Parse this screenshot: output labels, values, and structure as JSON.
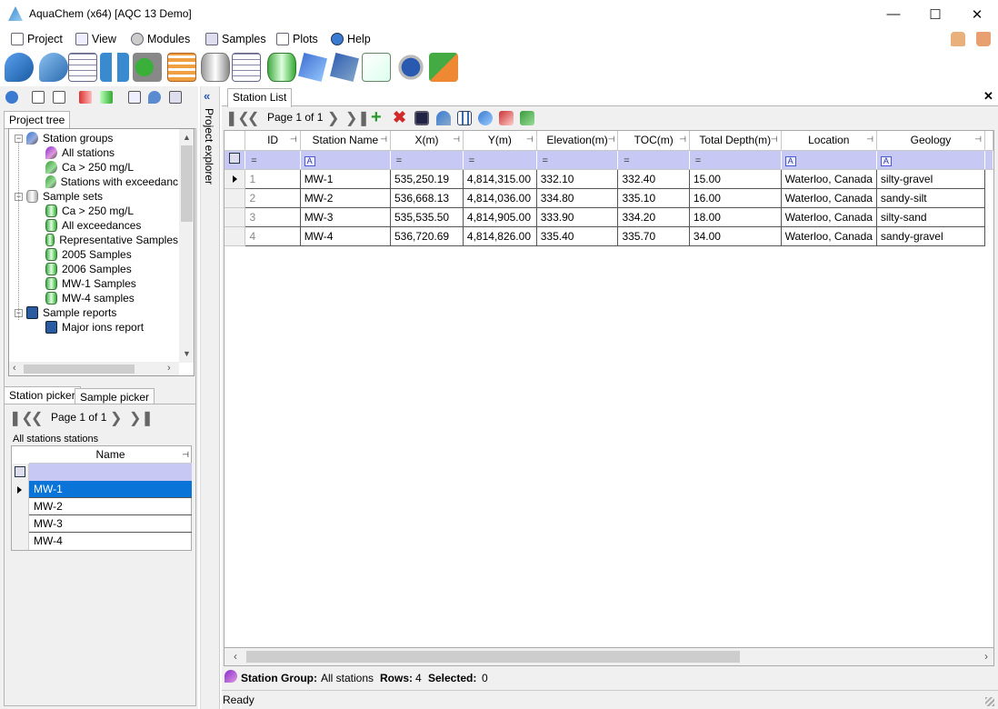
{
  "window": {
    "title": "AquaChem (x64) [AQC 13 Demo]"
  },
  "menu": [
    {
      "label": "Project",
      "icon": "document-icon"
    },
    {
      "label": "View",
      "icon": "window-icon"
    },
    {
      "label": "Modules",
      "icon": "gears-icon"
    },
    {
      "label": "Samples",
      "icon": "sample-search-icon"
    },
    {
      "label": "Plots",
      "icon": "plot-icon"
    },
    {
      "label": "Help",
      "icon": "help-icon"
    }
  ],
  "left": {
    "tabs": {
      "project_tree": "Project tree",
      "station_picker": "Station picker",
      "sample_picker": "Sample picker"
    },
    "tree": [
      {
        "label": "Station groups",
        "level": 0,
        "expander": "⊟",
        "icon": "pin"
      },
      {
        "label": "All stations",
        "level": 1,
        "icon": "pinp"
      },
      {
        "label": "Ca > 250 mg/L",
        "level": 1,
        "icon": "pin2"
      },
      {
        "label": "Stations with exceedanc",
        "level": 1,
        "icon": "pin2"
      },
      {
        "label": "Sample sets",
        "level": 0,
        "expander": "⊟",
        "icon": "can"
      },
      {
        "label": "Ca > 250 mg/L",
        "level": 1,
        "icon": "cang"
      },
      {
        "label": "All exceedances",
        "level": 1,
        "icon": "cang"
      },
      {
        "label": "Representative Samples",
        "level": 1,
        "icon": "cang"
      },
      {
        "label": "2005 Samples",
        "level": 1,
        "icon": "cang"
      },
      {
        "label": "2006 Samples",
        "level": 1,
        "icon": "cang"
      },
      {
        "label": "MW-1 Samples",
        "level": 1,
        "icon": "cang"
      },
      {
        "label": "MW-4 samples",
        "level": 1,
        "icon": "cang"
      },
      {
        "label": "Sample reports",
        "level": 0,
        "expander": "⊟",
        "icon": "book"
      },
      {
        "label": "Major ions report",
        "level": 1,
        "icon": "book"
      }
    ],
    "picker": {
      "page_label": "Page 1 of 1",
      "group_label": "All stations stations",
      "column": "Name",
      "rows": [
        "MW-1",
        "MW-2",
        "MW-3",
        "MW-4"
      ]
    }
  },
  "vertical_label": "Project explorer",
  "main": {
    "tab": "Station List",
    "page_label": "Page 1 of 1",
    "columns": [
      "ID",
      "Station Name",
      "X(m)",
      "Y(m)",
      "Elevation(m)",
      "TOC(m)",
      "Total Depth(m)",
      "Location",
      "Geology"
    ],
    "rows": [
      [
        "1",
        "MW-1",
        "535,250.19",
        "4,814,315.00",
        "332.10",
        "332.40",
        "15.00",
        "Waterloo, Canada",
        "silty-gravel"
      ],
      [
        "2",
        "MW-2",
        "536,668.13",
        "4,814,036.00",
        "334.80",
        "335.10",
        "16.00",
        "Waterloo, Canada",
        "sandy-silt"
      ],
      [
        "3",
        "MW-3",
        "535,535.50",
        "4,814,905.00",
        "333.90",
        "334.20",
        "18.00",
        "Waterloo, Canada",
        "silty-sand"
      ],
      [
        "4",
        "MW-4",
        "536,720.69",
        "4,814,826.00",
        "335.40",
        "335.70",
        "34.00",
        "Waterloo, Canada",
        "sandy-gravel"
      ]
    ],
    "status": {
      "group_key": "Station Group:",
      "group_val": "All stations",
      "rows_key": "Rows:",
      "rows_val": "4",
      "sel_key": "Selected:",
      "sel_val": "0"
    }
  },
  "statusbar": "Ready"
}
